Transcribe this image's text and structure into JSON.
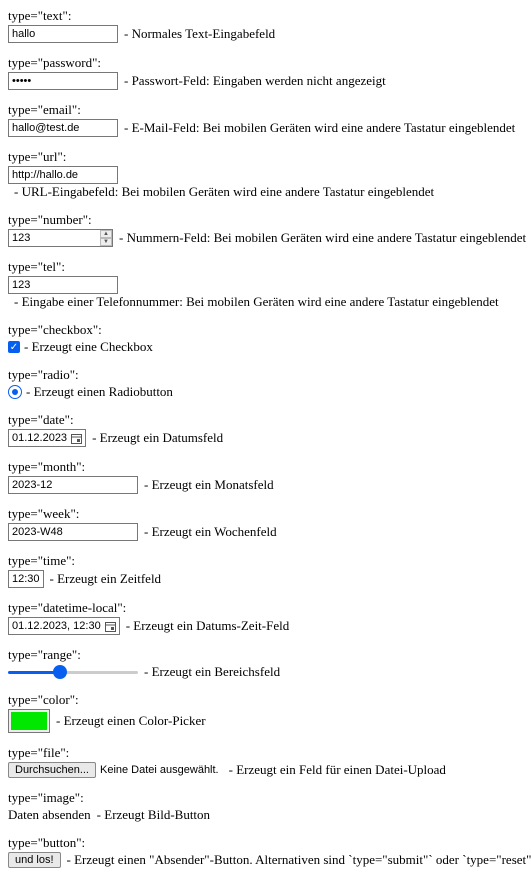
{
  "fields": {
    "text": {
      "label": "type=\"text\":",
      "value": "hallo",
      "desc": "- Normales Text-Eingabefeld"
    },
    "password": {
      "label": "type=\"password\":",
      "value": "•••••",
      "desc": "- Passwort-Feld: Eingaben werden nicht angezeigt"
    },
    "email": {
      "label": "type=\"email\":",
      "value": "hallo@test.de",
      "desc": "- E-Mail-Feld: Bei mobilen Geräten wird eine andere Tastatur eingeblendet"
    },
    "url": {
      "label": "type=\"url\":",
      "value": "http://hallo.de",
      "desc": "- URL-Eingabefeld: Bei mobilen Geräten wird eine andere Tastatur eingeblendet"
    },
    "number": {
      "label": "type=\"number\":",
      "value": "123",
      "desc": "- Nummern-Feld: Bei mobilen Geräten wird eine andere Tastatur eingeblendet"
    },
    "tel": {
      "label": "type=\"tel\":",
      "value": "123",
      "desc": "- Eingabe einer Telefonnummer: Bei mobilen Geräten wird eine andere Tastatur eingeblendet"
    },
    "checkbox": {
      "label": "type=\"checkbox\":",
      "desc": "- Erzeugt eine Checkbox"
    },
    "radio": {
      "label": "type=\"radio\":",
      "desc": "- Erzeugt einen Radiobutton"
    },
    "date": {
      "label": "type=\"date\":",
      "value": "01.12.2023",
      "desc": "- Erzeugt ein Datumsfeld"
    },
    "month": {
      "label": "type=\"month\":",
      "value": "2023-12",
      "desc": "- Erzeugt ein Monatsfeld"
    },
    "week": {
      "label": "type=\"week\":",
      "value": "2023-W48",
      "desc": "- Erzeugt ein Wochenfeld"
    },
    "time": {
      "label": "type=\"time\":",
      "value": "12:30",
      "desc": "- Erzeugt ein Zeitfeld"
    },
    "datetime": {
      "label": "type=\"datetime-local\":",
      "value": "01.12.2023, 12:30",
      "desc": "- Erzeugt ein Datums-Zeit-Feld"
    },
    "range": {
      "label": "type=\"range\":",
      "value": 40,
      "desc": "- Erzeugt ein Bereichsfeld"
    },
    "color": {
      "label": "type=\"color\":",
      "value": "#00e800",
      "desc": "- Erzeugt einen Color-Picker"
    },
    "file": {
      "label": "type=\"file\":",
      "button": "Durchsuchen...",
      "status": "Keine Datei ausgewählt.",
      "desc": "- Erzeugt ein Feld für einen Datei-Upload"
    },
    "image": {
      "label": "type=\"image\":",
      "alt": "Daten absenden",
      "desc": "- Erzeugt Bild-Button"
    },
    "button": {
      "label": "type=\"button\":",
      "text": "und los!",
      "desc": "- Erzeugt einen \"Absender\"-Button. Alternativen sind `type=\"submit\"` oder `type=\"reset\"`"
    }
  }
}
